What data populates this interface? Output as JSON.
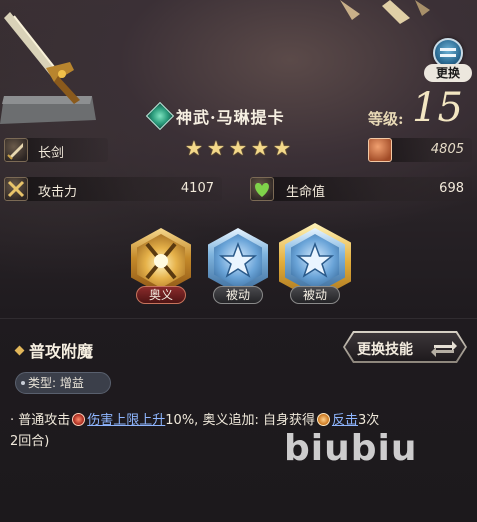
{
  "header": {
    "swap_button_label": "更换"
  },
  "character": {
    "name": "神武·马琳提卡",
    "star_count": 5,
    "level_label": "等级:",
    "level_value": "15"
  },
  "weapon": {
    "type": "长剑",
    "power": "4805"
  },
  "stats": {
    "attack_label": "攻击力",
    "attack_value": "4107",
    "hp_label": "生命值",
    "hp_value": "698"
  },
  "skills": [
    {
      "tag": "奥义",
      "style": "gold",
      "selected": false
    },
    {
      "tag": "被动",
      "style": "blue",
      "selected": false
    },
    {
      "tag": "被动",
      "style": "blue",
      "selected": true
    }
  ],
  "skill_detail": {
    "title": "普攻附魔",
    "change_button_label": "更换技能",
    "type_label": "类型:",
    "type_value": "增益",
    "desc_prefix": "· 普通攻击",
    "desc_keyword1": "伤害上限上升",
    "desc_middle": "10%, 奥义追加: 自身获得",
    "desc_keyword2": "反击",
    "desc_suffix": "3次",
    "desc_line2": "2回合)"
  },
  "watermark": "biubiu",
  "colors": {
    "accent_gold": "#f4d98a",
    "keyword_blue": "#8fb6ff",
    "hp_green": "#7fd34a"
  }
}
